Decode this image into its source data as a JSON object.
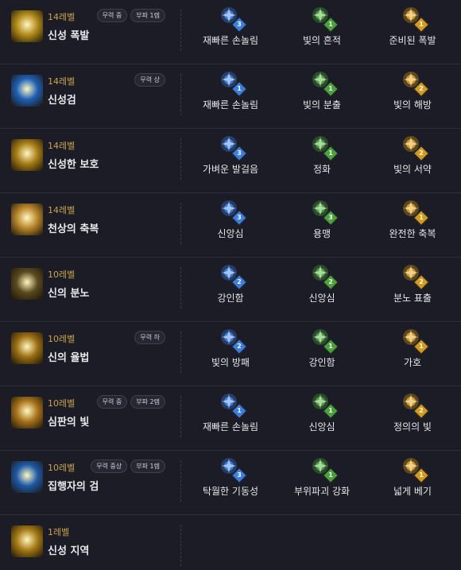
{
  "skills": [
    {
      "level": "14레벨",
      "name": "신성 폭발",
      "badges": [
        "무력 중",
        "부파 1렙"
      ],
      "icon": "holy-burst-icon",
      "bg": "#b08a18",
      "tripods": [
        {
          "name": "재빠른 손놀림",
          "icon": "swift-hand-icon",
          "tier": "3",
          "color": "blue"
        },
        {
          "name": "빛의 흔적",
          "icon": "light-trace-icon",
          "tier": "1",
          "color": "green"
        },
        {
          "name": "준비된 폭발",
          "icon": "ready-burst-icon",
          "tier": "1",
          "color": "gold"
        }
      ]
    },
    {
      "level": "14레벨",
      "name": "신성검",
      "badges": [
        "무력 상"
      ],
      "icon": "holy-sword-icon",
      "bg": "#1e5fb5",
      "tripods": [
        {
          "name": "재빠른 손놀림",
          "icon": "swift-hand-icon",
          "tier": "1",
          "color": "blue"
        },
        {
          "name": "빛의 분출",
          "icon": "light-eruption-icon",
          "tier": "1",
          "color": "green"
        },
        {
          "name": "빛의 해방",
          "icon": "light-release-icon",
          "tier": "2",
          "color": "gold"
        }
      ]
    },
    {
      "level": "14레벨",
      "name": "신성한 보호",
      "badges": [],
      "icon": "holy-protection-icon",
      "bg": "#a67c16",
      "tripods": [
        {
          "name": "가벼운 발걸음",
          "icon": "light-step-icon",
          "tier": "3",
          "color": "blue"
        },
        {
          "name": "정화",
          "icon": "purify-icon",
          "tier": "1",
          "color": "green"
        },
        {
          "name": "빛의 서약",
          "icon": "light-oath-icon",
          "tier": "2",
          "color": "gold"
        }
      ]
    },
    {
      "level": "14레벨",
      "name": "천상의 축복",
      "badges": [],
      "icon": "heavenly-blessing-icon",
      "bg": "#b7852a",
      "tripods": [
        {
          "name": "신앙심",
          "icon": "faith-icon",
          "tier": "3",
          "color": "blue"
        },
        {
          "name": "용맹",
          "icon": "valor-icon",
          "tier": "3",
          "color": "green"
        },
        {
          "name": "완전한 축복",
          "icon": "complete-blessing-icon",
          "tier": "1",
          "color": "gold"
        }
      ]
    },
    {
      "level": "10레벨",
      "name": "신의 분노",
      "badges": [],
      "icon": "divine-wrath-icon",
      "bg": "#5a4a1e",
      "tripods": [
        {
          "name": "강인함",
          "icon": "toughness-icon",
          "tier": "2",
          "color": "blue"
        },
        {
          "name": "신앙심",
          "icon": "faith-icon",
          "tier": "2",
          "color": "green"
        },
        {
          "name": "분노 표출",
          "icon": "rage-icon",
          "tier": "2",
          "color": "gold"
        }
      ]
    },
    {
      "level": "10레벨",
      "name": "신의 율법",
      "badges": [
        "무력 하"
      ],
      "icon": "divine-law-icon",
      "bg": "#9b6e12",
      "tripods": [
        {
          "name": "빛의 방패",
          "icon": "light-shield-icon",
          "tier": "2",
          "color": "blue"
        },
        {
          "name": "강인함",
          "icon": "toughness-icon",
          "tier": "1",
          "color": "green"
        },
        {
          "name": "가호",
          "icon": "divine-aid-icon",
          "tier": "1",
          "color": "gold"
        }
      ]
    },
    {
      "level": "10레벨",
      "name": "심판의 빛",
      "badges": [
        "무력 중",
        "부파 2렙"
      ],
      "icon": "judgment-light-icon",
      "bg": "#a8741a",
      "tripods": [
        {
          "name": "재빠른 손놀림",
          "icon": "swift-hand-icon",
          "tier": "1",
          "color": "blue"
        },
        {
          "name": "신앙심",
          "icon": "faith-icon",
          "tier": "1",
          "color": "green"
        },
        {
          "name": "정의의 빛",
          "icon": "justice-light-icon",
          "tier": "2",
          "color": "gold"
        }
      ]
    },
    {
      "level": "10레벨",
      "name": "집행자의 검",
      "badges": [
        "무력 중상",
        "부파 1렙"
      ],
      "icon": "executioner-sword-icon",
      "bg": "#1d5aa8",
      "tripods": [
        {
          "name": "탁월한 기동성",
          "icon": "mobility-icon",
          "tier": "3",
          "color": "blue"
        },
        {
          "name": "부위파괴 강화",
          "icon": "part-break-icon",
          "tier": "1",
          "color": "green"
        },
        {
          "name": "넓게 베기",
          "icon": "wide-slash-icon",
          "tier": "1",
          "color": "gold"
        }
      ]
    },
    {
      "level": "1레벨",
      "name": "신성 지역",
      "badges": [],
      "icon": "holy-zone-icon",
      "bg": "#a47a14",
      "tripods": []
    }
  ]
}
